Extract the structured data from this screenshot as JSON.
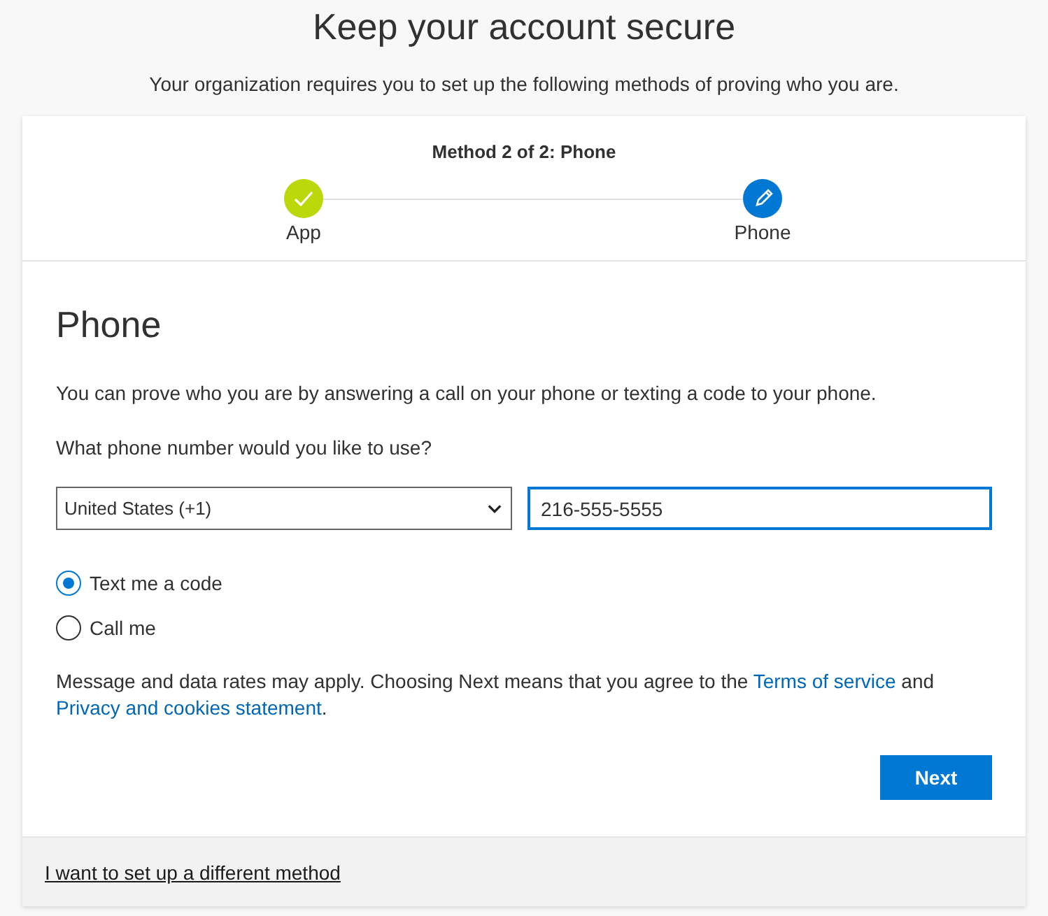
{
  "title": "Keep your account secure",
  "subtitle": "Your organization requires you to set up the following methods of proving who you are.",
  "progress": {
    "caption": "Method 2 of 2: Phone",
    "steps": [
      {
        "label": "App",
        "done": true
      },
      {
        "label": "Phone",
        "done": false
      }
    ]
  },
  "method": {
    "heading": "Phone",
    "description": "You can prove who you are by answering a call on your phone or texting a code to your phone.",
    "question": "What phone number would you like to use?",
    "country": {
      "value": "United States (+1)"
    },
    "phone": {
      "value": "216-555-5555",
      "focused": true
    },
    "options": [
      {
        "label": "Text me a code",
        "selected": true
      },
      {
        "label": "Call me",
        "selected": false
      }
    ],
    "disclaimer": {
      "text": "Message and data rates may apply. Choosing Next means that you agree to the ",
      "links": [
        {
          "label": "Terms of service"
        },
        {
          "label": "Privacy and cookies statement"
        }
      ],
      "joiner": " and ",
      "end": "."
    },
    "next_button": "Next"
  },
  "footer_link": "I want to set up a different method"
}
